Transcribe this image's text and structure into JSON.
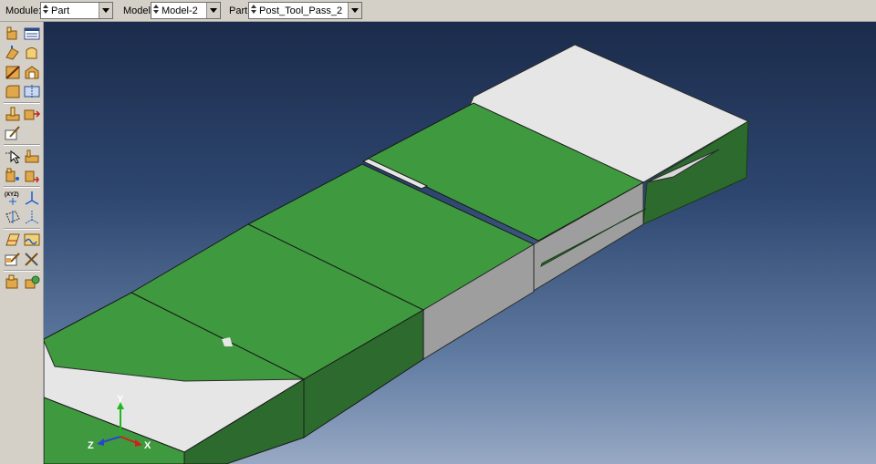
{
  "context_bar": {
    "module": {
      "label": "Module:",
      "value": "Part"
    },
    "model": {
      "label": "Model:",
      "value": "Model-2"
    },
    "part": {
      "label": "Part:",
      "value": "Post_Tool_Pass_2"
    }
  },
  "toolbox": {
    "icons": [
      "create-part-icon",
      "part-manager-icon",
      "create-solid-extrude-icon",
      "create-solid-revolve-icon",
      "create-cut-icon",
      "create-shell-icon",
      "create-round-icon",
      "create-partition-icon",
      "create-datum-icon",
      "datum-manager-icon",
      "edit-feature-icon",
      "query-icon",
      "repair-icon",
      "create-wire-icon",
      "merge-icon",
      "create-coordinate-icon",
      "datum-axis-icon",
      "datum-plane-icon",
      "datum-csys-icon",
      "create-set-icon",
      "create-surface-icon",
      "edit-mesh-icon",
      "tools-icon",
      "part-display-icon",
      "instance-icon"
    ]
  },
  "triad": {
    "x_label": "X",
    "y_label": "Y",
    "z_label": "Z",
    "x_color": "#d01f1f",
    "y_color": "#1fb61f",
    "z_color": "#2a45c8"
  },
  "colors": {
    "face_green_top": "#3f9a3f",
    "face_green_side": "#2d6a2d",
    "face_white": "#e6e6e6",
    "face_gray": "#9e9e9e"
  }
}
